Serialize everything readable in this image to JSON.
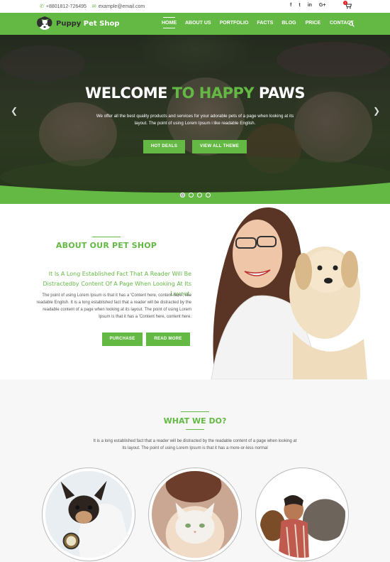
{
  "topbar": {
    "phone": "+8801812-726495",
    "email": "example@email.com",
    "social": [
      "f",
      "t",
      "in",
      "G+"
    ],
    "cart_count": "1"
  },
  "brand": {
    "name_part1": "Puppy",
    "name_part2": "Pet Shop"
  },
  "nav": {
    "items": [
      {
        "label": "HOME",
        "active": true
      },
      {
        "label": "ABOUT US"
      },
      {
        "label": "PORTFOLIO"
      },
      {
        "label": "FACTS"
      },
      {
        "label": "BLOG"
      },
      {
        "label": "PRICE"
      },
      {
        "label": "CONTACT"
      }
    ]
  },
  "hero": {
    "title_white": "WELCOME",
    "title_green": "TO HAPPY",
    "title_white2": "PAWS",
    "text": "We offer all the best quality products and services for your adorable pets of a page when looking at its layout. The point of using Lorem Ipsum i like readable English.",
    "btn_primary": "HOT DEALS",
    "btn_secondary": "VIEW ALL THEME",
    "slides": 4,
    "active_slide": 1
  },
  "about": {
    "heading": "ABOUT OUR PET SHOP",
    "subheading": "It Is A Long Established Fact That A Reader Will Be Distractedby Content Of A Page When Looking At Its Layout.",
    "text": "The point of using Lorem Ipsum is that it has a 'Content here, content here', like readable English. It is a long established fact that a reader will be distracted by the readable content of a page when looking at its layout. The point of using Lorem Ipsum is that it has a 'Content here, content here.",
    "btn_purchase": "PURCHASE",
    "btn_read_more": "READ MORE"
  },
  "what": {
    "heading": "WHAT WE DO?",
    "text": "It is a long established fact that a reader will be distracted by the readable content of a page when looking at its layout. The point of using Lorem Ipsum is that it has a more-or-less normal"
  },
  "colors": {
    "accent": "#63b944",
    "hero_overlay": "#2c3527",
    "text": "#555555"
  }
}
